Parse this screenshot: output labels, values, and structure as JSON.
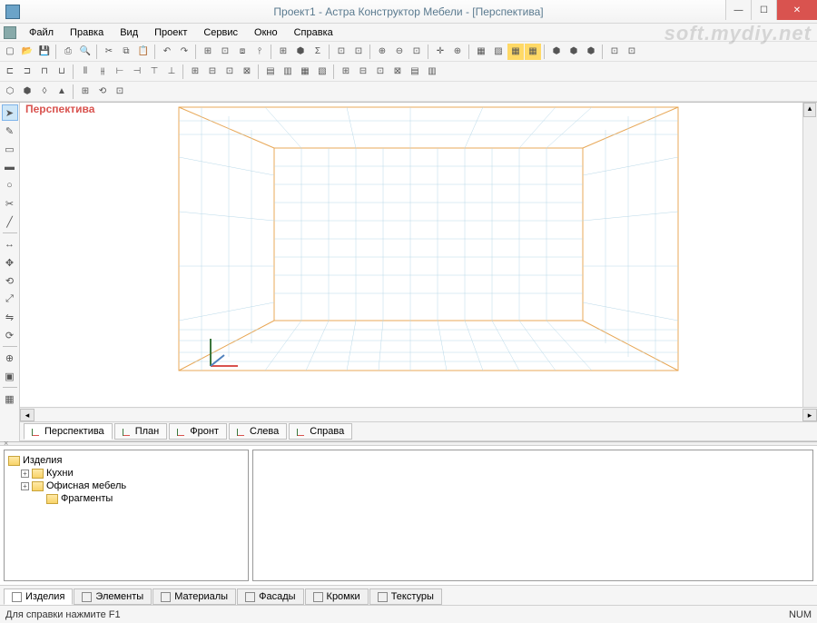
{
  "window": {
    "title": "Проект1 - Астра Конструктор Мебели - [Перспектива]"
  },
  "watermark": "soft.mydiy.net",
  "menu": {
    "items": [
      "Файл",
      "Правка",
      "Вид",
      "Проект",
      "Сервис",
      "Окно",
      "Справка"
    ]
  },
  "viewport": {
    "label": "Перспектива"
  },
  "view_tabs": [
    {
      "label": "Перспектива",
      "active": true
    },
    {
      "label": "План",
      "active": false
    },
    {
      "label": "Фронт",
      "active": false
    },
    {
      "label": "Слева",
      "active": false
    },
    {
      "label": "Справа",
      "active": false
    }
  ],
  "tree": {
    "root": "Изделия",
    "children": [
      {
        "label": "Кухни",
        "expandable": true
      },
      {
        "label": "Офисная мебель",
        "expandable": true
      },
      {
        "label": "Фрагменты",
        "expandable": false
      }
    ]
  },
  "bottom_tabs": [
    {
      "label": "Изделия",
      "active": true,
      "color": "#8a9a5b"
    },
    {
      "label": "Элементы",
      "active": false,
      "color": "#c0504d"
    },
    {
      "label": "Материалы",
      "active": false,
      "color": "#7f7f7f"
    },
    {
      "label": "Фасады",
      "active": false,
      "color": "#8a9a5b"
    },
    {
      "label": "Кромки",
      "active": false,
      "color": "#4f81bd"
    },
    {
      "label": "Текстуры",
      "active": false,
      "color": "#9bbb59"
    }
  ],
  "status": {
    "help": "Для справки нажмите F1",
    "indicator": "NUM"
  }
}
